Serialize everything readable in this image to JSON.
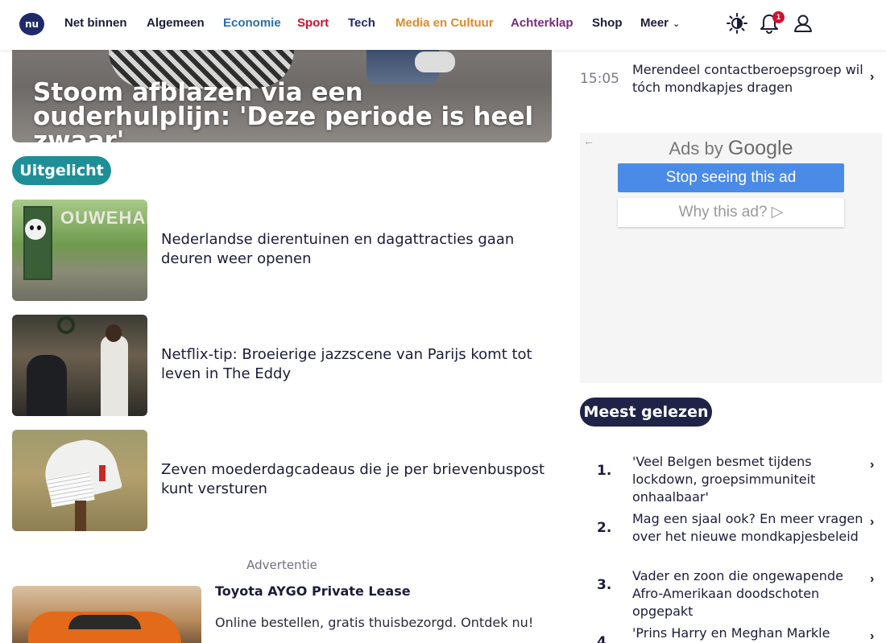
{
  "nav": {
    "logo_text": "nu",
    "items": [
      {
        "label": "Net binnen",
        "color": "#1c1c3a"
      },
      {
        "label": "Algemeen",
        "color": "#1c1c3a"
      },
      {
        "label": "Economie",
        "color": "#2a6fa8"
      },
      {
        "label": "Sport",
        "color": "#d3102b"
      },
      {
        "label": "Tech",
        "color": "#1f2a6b"
      },
      {
        "label": "Media en Cultuur",
        "color": "#e08a2a"
      },
      {
        "label": "Achterklap",
        "color": "#7a2a7a"
      },
      {
        "label": "Shop",
        "color": "#1c1c3a"
      },
      {
        "label": "Meer",
        "color": "#1c1c3a"
      }
    ],
    "icons": [
      "theme-toggle-icon",
      "bell-icon",
      "user-icon"
    ],
    "notification_count": "1"
  },
  "hero": {
    "title": "Stoom afblazen via een ouderhulplijn: 'Deze periode is heel zwaar'"
  },
  "featured": {
    "heading": "Uitgelicht",
    "items": [
      {
        "title": "Nederlandse dierentuinen en dagattracties gaan deuren weer openen",
        "image_text": "OUWEHAND"
      },
      {
        "title": "Netflix-tip: Broeierige jazzscene van Parijs komt tot leven in The Eddy"
      },
      {
        "title": "Zeven moederdagcadeaus die je per brievenbuspost kunt versturen"
      }
    ]
  },
  "advert": {
    "label": "Advertentie",
    "title": "Toyota AYGO Private Lease",
    "description": "Online bestellen, gratis thuisbezorgd. Ontdek nu!"
  },
  "latest": {
    "time": "15:05",
    "text": "Merendeel contactberoepsgroep wil tóch mondkapjes dragen"
  },
  "google_ad": {
    "ads_by": "Ads by",
    "google": "Google",
    "stop_label": "Stop seeing this ad",
    "why_label": "Why this ad? ▷"
  },
  "most_read": {
    "heading": "Meest gelezen",
    "items": [
      {
        "rank": "1.",
        "title": "'Veel Belgen besmet tijdens lockdown, groepsimmuniteit onhaalbaar'"
      },
      {
        "rank": "2.",
        "title": "Mag een sjaal ook? En meer vragen over het nieuwe mondkapjesbeleid"
      },
      {
        "rank": "3.",
        "title": "Vader en zoon die ongewapende Afro-Amerikaan doodschoten opgepakt"
      },
      {
        "rank": "4.",
        "title": "'Prins Harry en Meghan Markle wonen"
      }
    ]
  }
}
